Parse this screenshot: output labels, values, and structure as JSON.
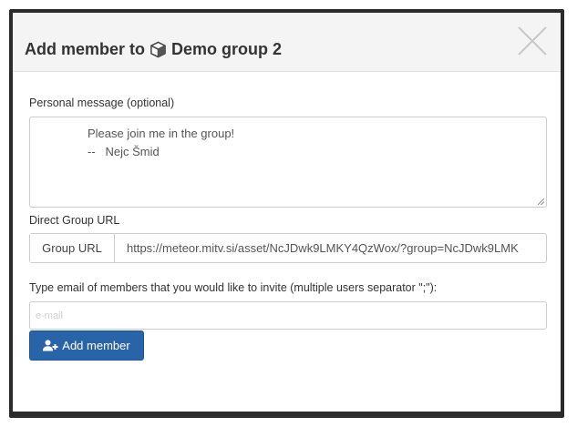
{
  "modal": {
    "title_prefix": "Add member to",
    "group_name": "Demo group 2"
  },
  "message": {
    "label": "Personal message (optional)",
    "line1": "Please join me in the group!",
    "line2": "--   Nejc Šmid"
  },
  "direct_url": {
    "label": "Direct Group URL",
    "addon": "Group URL",
    "value": "https://meteor.mitv.si/asset/NcJDwk9LMKY4QzWox/?group=NcJDwk9LMK"
  },
  "invite": {
    "label": "Type email of members that you would like to invite (multiple users separator \";\"):",
    "placeholder": "e-mail",
    "button": "Add member"
  },
  "icons": {
    "group": "cube-icon",
    "close": "close-icon",
    "add": "add-user-icon"
  }
}
